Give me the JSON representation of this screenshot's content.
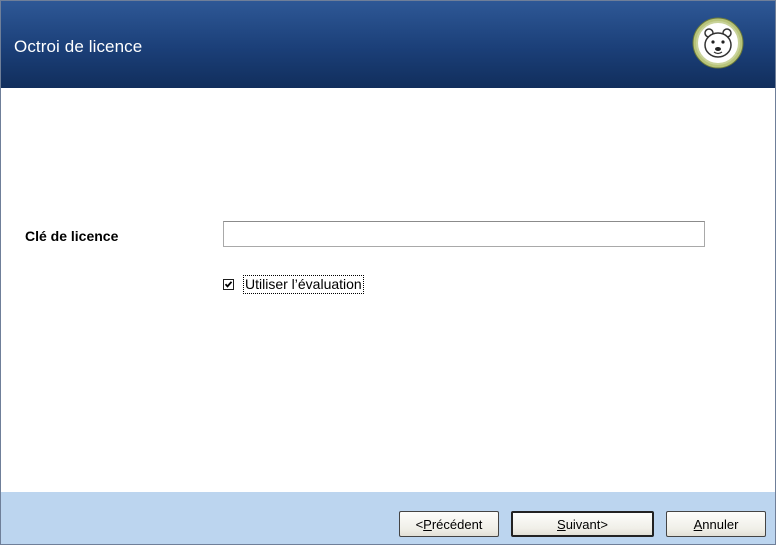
{
  "header": {
    "title": "Octroi de licence",
    "logo_icon": "polar-bear-icon"
  },
  "form": {
    "license_key_label": "Clé de licence",
    "license_key_value": "",
    "license_key_placeholder": "",
    "evaluation_checkbox": {
      "label": "Utiliser l’évaluation",
      "checked": true
    }
  },
  "footer": {
    "prev_label": {
      "accel": "P",
      "rest": "récédent",
      "prefix": "<"
    },
    "next_label": {
      "accel": "S",
      "rest": "uivant>"
    },
    "cancel_label": {
      "accel": "A",
      "rest": "nnuler"
    }
  },
  "colors": {
    "header_bg": "#1b3f78",
    "footer_bg": "#bcd5ef",
    "content_bg": "#ffffff"
  }
}
